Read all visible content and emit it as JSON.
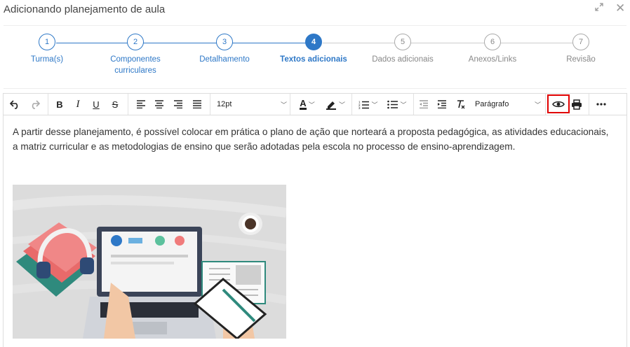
{
  "window": {
    "title": "Adicionando planejamento de aula",
    "expand_icon": "expand-icon",
    "close_icon": "close-icon"
  },
  "stepper": {
    "steps": [
      {
        "number": "1",
        "label": "Turma(s)",
        "state": "done"
      },
      {
        "number": "2",
        "label": "Componentes curriculares",
        "state": "done"
      },
      {
        "number": "3",
        "label": "Detalhamento",
        "state": "done"
      },
      {
        "number": "4",
        "label": "Textos adicionais",
        "state": "active"
      },
      {
        "number": "5",
        "label": "Dados adicionais",
        "state": "future"
      },
      {
        "number": "6",
        "label": "Anexos/Links",
        "state": "future"
      },
      {
        "number": "7",
        "label": "Revisão",
        "state": "future"
      }
    ]
  },
  "toolbar": {
    "bold": "B",
    "italic": "I",
    "underline": "U",
    "strike": "S",
    "font_size": "12pt",
    "block_format": "Parágrafo",
    "text_color_letter": "A"
  },
  "content": {
    "paragraph": "A partir desse planejamento, é possível colocar em prática o plano de ação que norteará a proposta pedagógica, as atividades educacionais, a matriz curricular e as metodologias de ensino que serão adotadas pela escola no processo de ensino-aprendizagem."
  },
  "colors": {
    "accent": "#2e78c7",
    "highlight": "#e00000"
  }
}
